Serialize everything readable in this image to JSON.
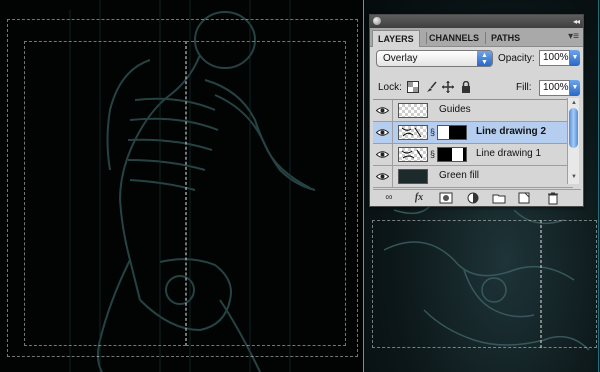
{
  "panel": {
    "tabs": [
      "LAYERS",
      "CHANNELS",
      "PATHS"
    ],
    "active_tab": "LAYERS",
    "blend_mode": "Overlay",
    "opacity_label": "Opacity:",
    "opacity_value": "100%",
    "lock_label": "Lock:",
    "fill_label": "Fill:",
    "fill_value": "100%",
    "layers": [
      {
        "name": "Guides",
        "visible": true,
        "selected": false
      },
      {
        "name": "Line drawing 2",
        "visible": true,
        "selected": true
      },
      {
        "name": "Line drawing 1",
        "visible": true,
        "selected": false
      },
      {
        "name": "Green fill",
        "visible": true,
        "selected": false
      }
    ],
    "footer_icons": [
      "link-icon",
      "fx-icon",
      "mask-icon",
      "adjustment-icon",
      "group-folder-icon",
      "new-layer-icon",
      "trash-icon"
    ],
    "fx_label": "fx",
    "panel_menu_glyph": "▾≡",
    "collapse_glyph": "◂◂"
  },
  "colors": {
    "guide": "#23b3b8",
    "selection": "#b5cef0",
    "accent": "#2868c8"
  }
}
